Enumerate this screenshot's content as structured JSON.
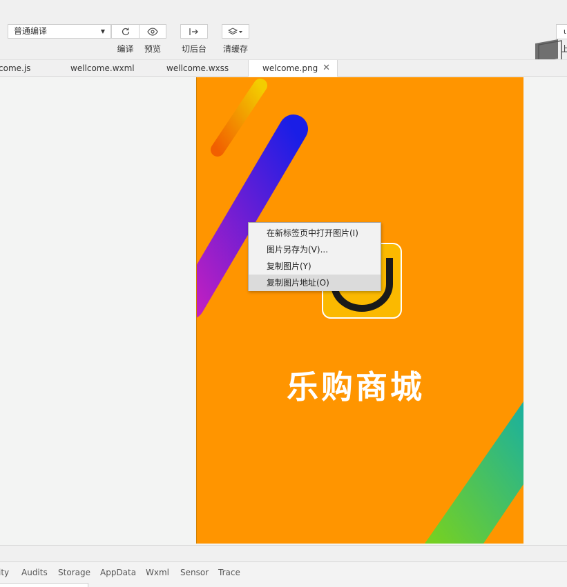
{
  "toolbar": {
    "compile_mode": "普通编译",
    "buttons": [
      {
        "label": "编译",
        "icon": "refresh-icon"
      },
      {
        "label": "预览",
        "icon": "eye-icon"
      },
      {
        "label": "切后台",
        "icon": "switch-background-icon"
      },
      {
        "label": "清缓存",
        "icon": "layers-icon"
      }
    ],
    "corner_label": "上",
    "corner_button_text": "ι"
  },
  "tabs": [
    {
      "label": "come.js",
      "active": false
    },
    {
      "label": "wellcome.wxml",
      "active": false
    },
    {
      "label": "wellcome.wxss",
      "active": false
    },
    {
      "label": "welcome.png",
      "active": true
    }
  ],
  "tab_close_glyph": "✕",
  "image": {
    "title_text": "乐购商城",
    "background_color": "#ff9500"
  },
  "context_menu": {
    "items": [
      {
        "label": "在新标签页中打开图片(I)",
        "highlighted": false
      },
      {
        "label": "图片另存为(V)...",
        "highlighted": false
      },
      {
        "label": "复制图片(Y)",
        "highlighted": false
      },
      {
        "label": "复制图片地址(O)",
        "highlighted": true
      }
    ]
  },
  "bottom_panel": {
    "tabs": [
      "ity",
      "Audits",
      "Storage",
      "AppData",
      "Wxml",
      "Sensor",
      "Trace"
    ]
  }
}
